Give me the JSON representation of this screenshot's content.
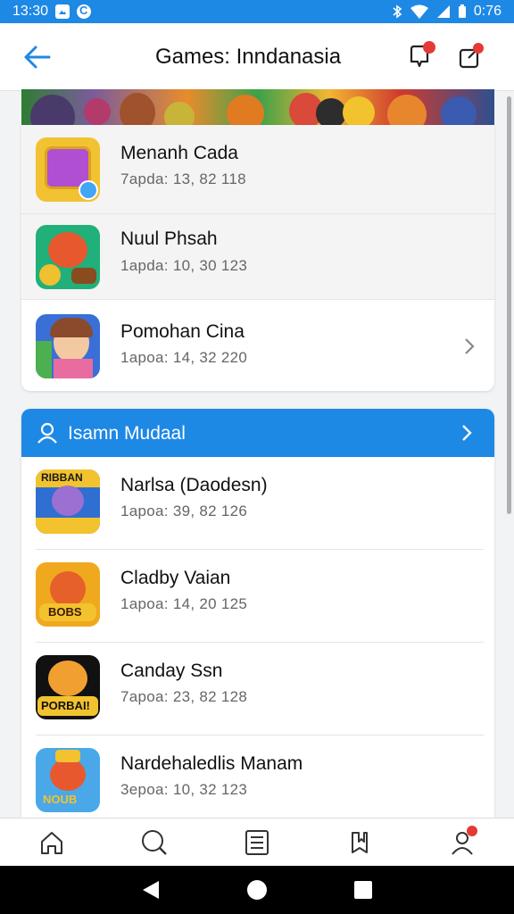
{
  "status_bar": {
    "time": "13:30",
    "battery": "0:76"
  },
  "app_bar": {
    "title": "Games: Inndanasia"
  },
  "top_list": [
    {
      "name": "Menanh Cada",
      "meta": "7apda:  13, 82 118",
      "shaded": true,
      "chevron": false
    },
    {
      "name": "Nuul Phsah",
      "meta": "1apda:  10, 30 123",
      "shaded": true,
      "chevron": false
    },
    {
      "name": "Pomohan Cina",
      "meta": "1apoa:  14, 32 220",
      "shaded": false,
      "chevron": true
    }
  ],
  "section": {
    "title": "Isamn Mudaal",
    "items": [
      {
        "name": "Narlsa (Daodesn)",
        "meta": "1apoa:  39, 82 126",
        "icon_text": "RIBBAN"
      },
      {
        "name": "Cladby Vaian",
        "meta": "1apoa:  14, 20 125",
        "icon_text": "BOBS"
      },
      {
        "name": "Canday Ssn",
        "meta": "7apoa:  23, 82 128",
        "icon_text": "PORBAI!"
      },
      {
        "name": "Nardehaledlis Manam",
        "meta": "3epoa:  10, 32 123",
        "icon_text": "NOUB"
      }
    ]
  },
  "bottom_nav": [
    {
      "icon": "home-icon"
    },
    {
      "icon": "search-icon"
    },
    {
      "icon": "list-icon"
    },
    {
      "icon": "bookmark-icon"
    },
    {
      "icon": "profile-icon",
      "badge": true
    }
  ],
  "colors": {
    "primary": "#1e88e5",
    "badge": "#e53935"
  }
}
